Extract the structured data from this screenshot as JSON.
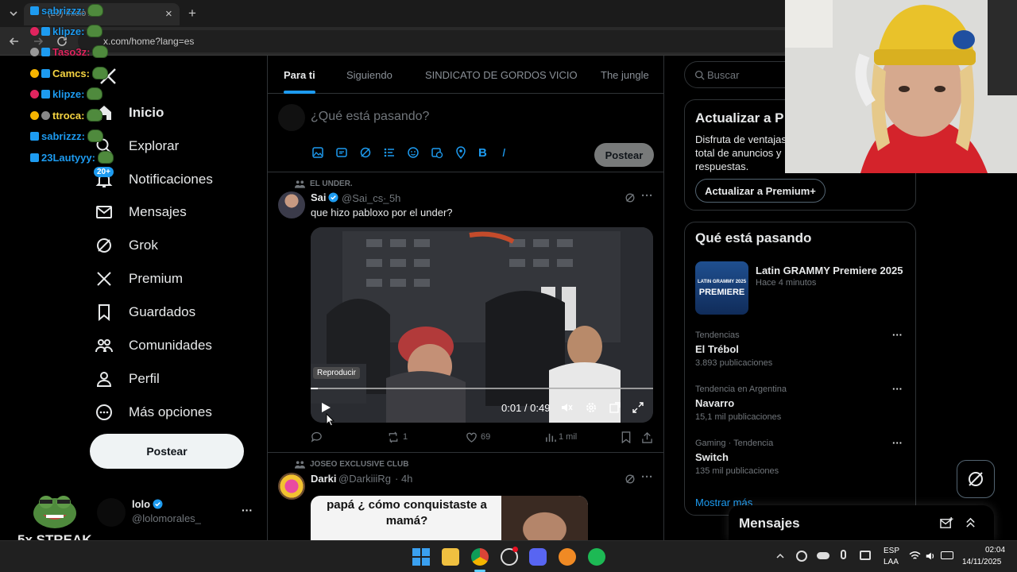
{
  "browser": {
    "tab_title": "(20) Inicio / X",
    "address": "x.com/home?lang=es",
    "close_symbol": "×",
    "new_tab_symbol": "+"
  },
  "chat_overlay": [
    {
      "user": "sabrizzz:",
      "color": "#1d9bf0"
    },
    {
      "user": "klipze:",
      "color": "#1d9bf0"
    },
    {
      "user": "Taso3z:",
      "color": "#e0245e"
    },
    {
      "user": "Camcs:",
      "color": "#f5d442"
    },
    {
      "user": "klipze:",
      "color": "#1d9bf0"
    },
    {
      "user": "ttroca:",
      "color": "#f5d442"
    },
    {
      "user": "sabrizzz:",
      "color": "#1d9bf0"
    },
    {
      "user": "23Lautyyy:",
      "color": "#1d9bf0"
    }
  ],
  "notif_count": "20+",
  "streak": "5x STREAK",
  "sidebar": {
    "items": [
      {
        "label": "Inicio",
        "icon": "home-icon"
      },
      {
        "label": "Explorar",
        "icon": "search-icon"
      },
      {
        "label": "Notificaciones",
        "icon": "bell-icon"
      },
      {
        "label": "Mensajes",
        "icon": "mail-icon"
      },
      {
        "label": "Grok",
        "icon": "grok-icon"
      },
      {
        "label": "Premium",
        "icon": "x-logo-icon"
      },
      {
        "label": "Guardados",
        "icon": "bookmark-icon"
      },
      {
        "label": "Comunidades",
        "icon": "communities-icon"
      },
      {
        "label": "Perfil",
        "icon": "person-icon"
      },
      {
        "label": "Más opciones",
        "icon": "more-circle-icon"
      }
    ],
    "post_button": "Postear",
    "account": {
      "name": "lolo",
      "handle": "@lolomorales_",
      "more": "···"
    }
  },
  "timeline": {
    "tabs": [
      "Para ti",
      "Siguiendo",
      "SINDICATO DE GORDOS VICIO",
      "The jungle"
    ],
    "compose": {
      "placeholder": "¿Qué está pasando?",
      "post_button": "Postear"
    },
    "posts": [
      {
        "community": "EL UNDER.",
        "name": "Sai",
        "handle": "@Sai_cs_",
        "time": "· 5h",
        "text": "que hizo pabloxo por el under?",
        "video": {
          "tooltip": "Reproducir",
          "time": "0:01 / 0:49",
          "progress": 0.02
        },
        "stats": {
          "replies": "",
          "reposts": "1",
          "likes": "69",
          "views": "1 mil"
        }
      },
      {
        "community": "JOSEO EXCLUSIVE CLUB",
        "name": "Darki",
        "handle": "@DarkiiiRg",
        "time": "· 4h",
        "meme_text": "papá ¿ cómo conquistaste a mamá?"
      }
    ]
  },
  "right": {
    "search_placeholder": "Buscar",
    "premium": {
      "title": "Actualizar a P",
      "body": "Disfruta de ventajas total de anuncios y respuestas.",
      "button": "Actualizar a Premium+"
    },
    "trends_title": "Qué está pasando",
    "event": {
      "name": "Latin GRAMMY Premiere 2025",
      "time": "Hace 4 minutos",
      "thumb_top": "LATIN GRAMMY 2025",
      "thumb_main": "PREMIERE"
    },
    "trends": [
      {
        "category": "Tendencias",
        "name": "El Trébol",
        "count": "3.893 publicaciones"
      },
      {
        "category": "Tendencia en Argentina",
        "name": "Navarro",
        "count": "15,1 mil publicaciones"
      },
      {
        "category": "Gaming · Tendencia",
        "name": "Switch",
        "count": "135 mil publicaciones"
      }
    ],
    "show_more": "Mostrar más",
    "messages_title": "Mensajes"
  },
  "taskbar": {
    "lang_top": "ESP",
    "lang_bottom": "LAA",
    "time": "02:04",
    "date": "14/11/2025"
  },
  "colors": {
    "accent": "#1d9bf0",
    "bg": "#000000",
    "border": "#2f3336"
  }
}
